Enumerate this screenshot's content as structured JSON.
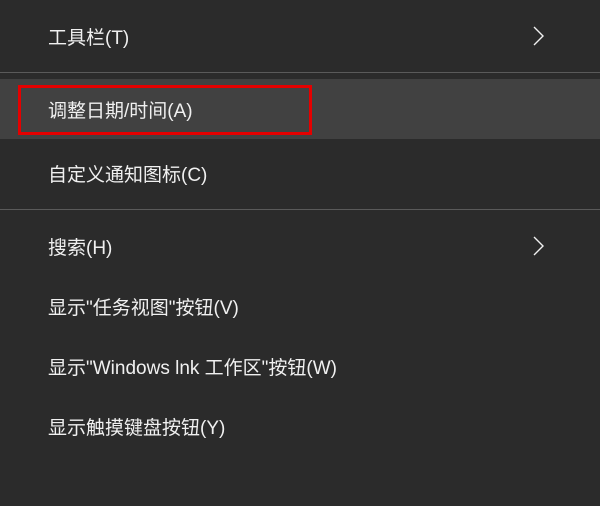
{
  "menu": {
    "toolbars": {
      "label": "工具栏(T)"
    },
    "adjust_datetime": {
      "label": "调整日期/时间(A)"
    },
    "custom_notify_icons": {
      "label": "自定义通知图标(C)"
    },
    "search": {
      "label": "搜索(H)"
    },
    "show_task_view": {
      "label": "显示\"任务视图\"按钮(V)"
    },
    "show_windows_ink": {
      "label": "显示\"Windows lnk 工作区\"按钮(W)"
    },
    "show_touch_keyboard": {
      "label": "显示触摸键盘按钮(Y)"
    }
  }
}
